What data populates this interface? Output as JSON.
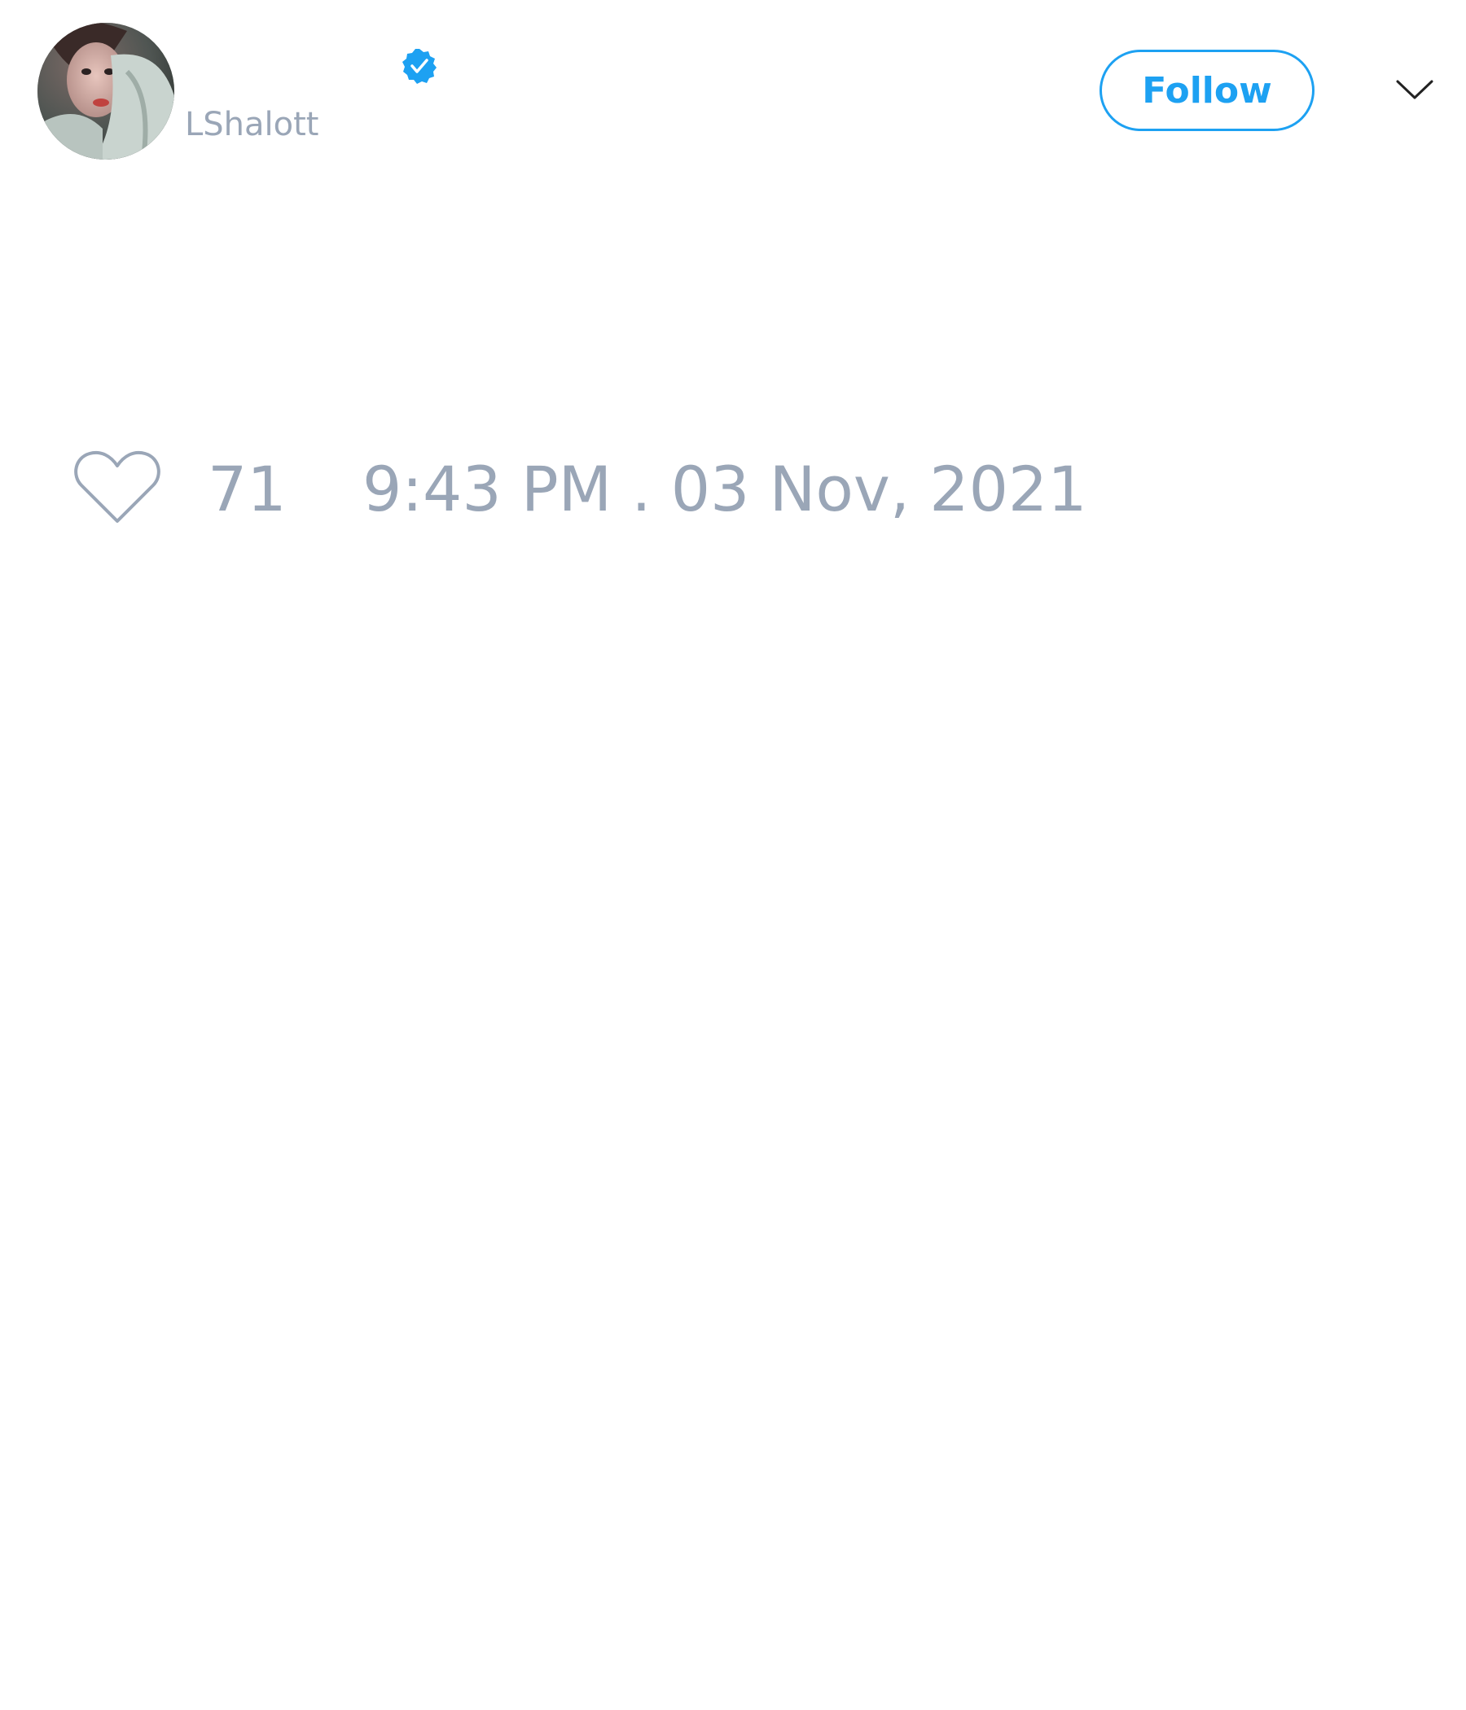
{
  "tweet": {
    "author": {
      "handle": "LShalott",
      "verified": true
    },
    "actions": {
      "follow_label": "Follow"
    },
    "likes": "71",
    "timestamp": "9:43 PM . 03 Nov, 2021"
  },
  "colors": {
    "accent": "#1da1f2",
    "muted_text": "#9aa6b7",
    "background": "#ffffff"
  },
  "icons": {
    "verified": "verified-badge-icon",
    "menu": "chevron-down-icon",
    "like": "heart-outline-icon"
  }
}
